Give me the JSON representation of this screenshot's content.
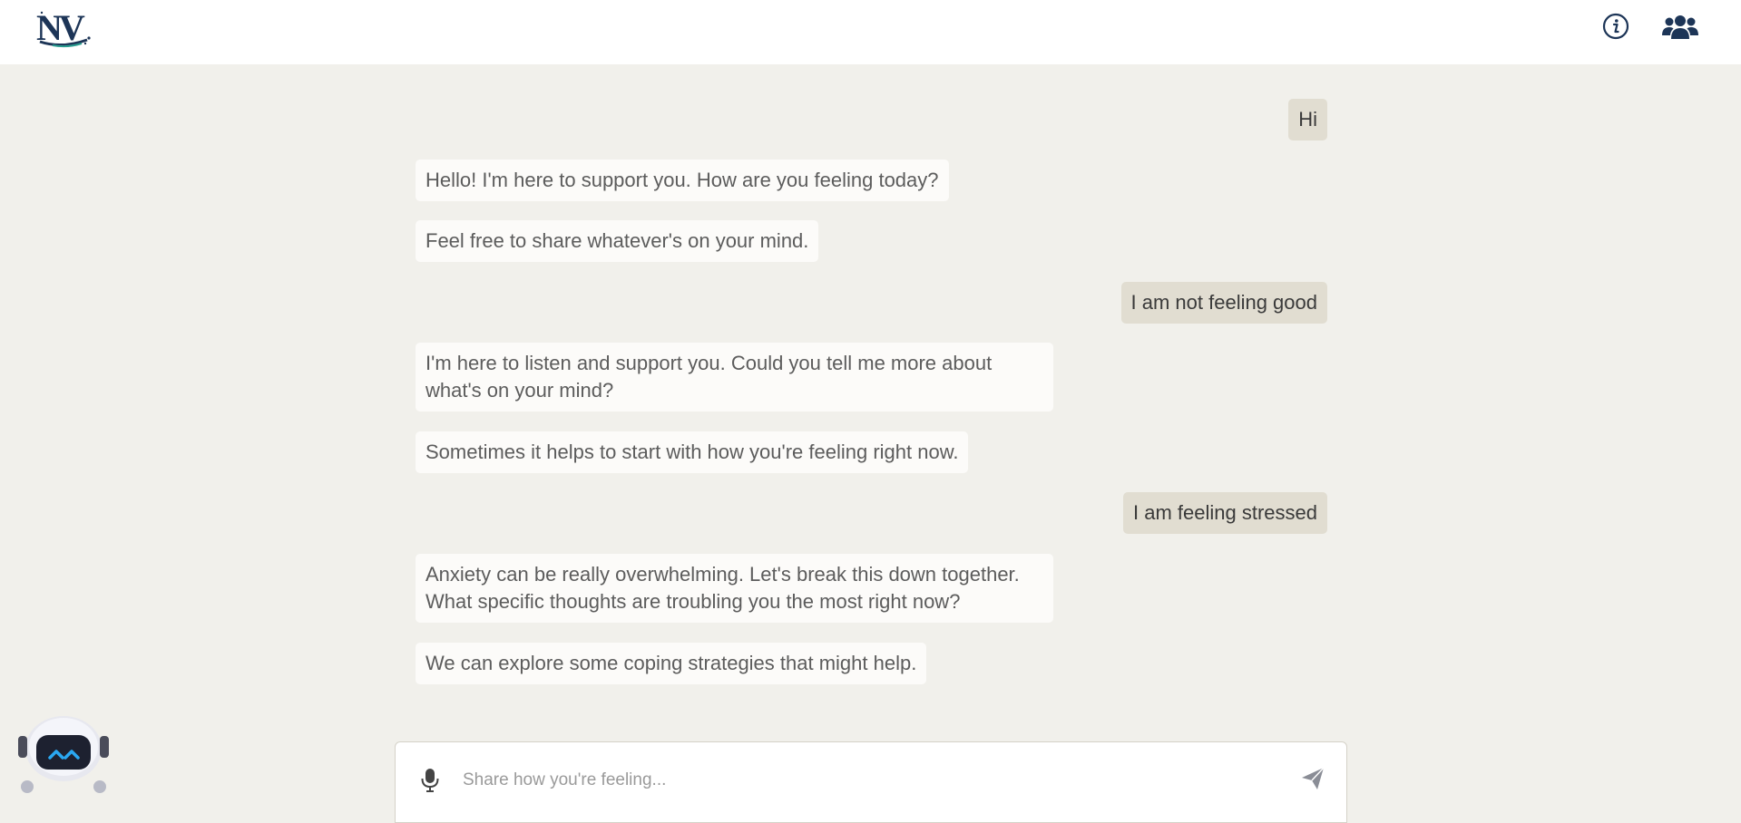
{
  "header": {
    "logo_text": "NV"
  },
  "messages": [
    {
      "role": "user",
      "text": "Hi"
    },
    {
      "role": "bot",
      "text": "Hello! I'm here to support you. How are you feeling today?"
    },
    {
      "role": "bot",
      "text": "Feel free to share whatever's on your mind."
    },
    {
      "role": "user",
      "text": "I am not feeling good"
    },
    {
      "role": "bot",
      "text": "I'm here to listen and support you. Could you tell me more about what's on your mind?"
    },
    {
      "role": "bot",
      "text": "Sometimes it helps to start with how you're feeling right now."
    },
    {
      "role": "user",
      "text": "I am feeling stressed"
    },
    {
      "role": "bot",
      "text": "Anxiety can be really overwhelming. Let's break this down together. What specific thoughts are troubling you the most right now?"
    },
    {
      "role": "bot",
      "text": "We can explore some coping strategies that might help."
    }
  ],
  "composer": {
    "placeholder": "Share how you're feeling...",
    "value": ""
  },
  "icons": {
    "info": "info-circle-icon",
    "community": "users-icon",
    "mic": "microphone-icon",
    "send": "paper-plane-icon",
    "assistant": "robot-avatar-icon"
  },
  "colors": {
    "background": "#f1f0eb",
    "header": "#ffffff",
    "user_bubble": "#e1ddd1",
    "bot_bubble": "#fcfbf9",
    "brand_navy": "#1d3557",
    "accent_blue": "#2aa8f2"
  }
}
